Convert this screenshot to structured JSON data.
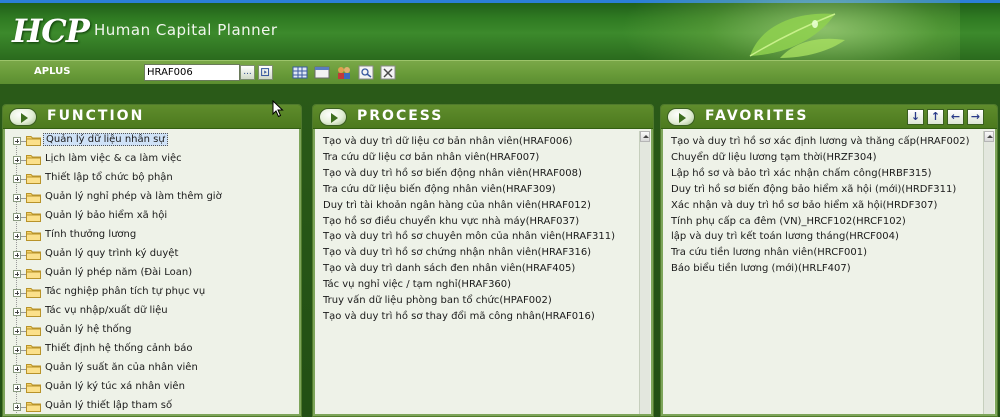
{
  "header": {
    "logo_text": "HCP",
    "app_title": "Human Capital Planner"
  },
  "toolbar": {
    "company": "APLUS",
    "function_code": "HRAF006",
    "lookup_label": "...",
    "icons": [
      "grid-icon",
      "window-icon",
      "users-icon",
      "search-icon",
      "tools-icon"
    ]
  },
  "function_panel": {
    "title": "FUNCTION",
    "items": [
      "Quản lý dữ liệu nhân sự",
      "Lịch làm việc & ca làm việc",
      "Thiết lập tổ chức bộ phận",
      "Quản lý nghỉ phép và làm thêm giờ",
      "Quản lý bảo hiểm xã hội",
      "Tính thưởng lương",
      "Quản lý quy trình ký duyệt",
      "Quản lý phép năm (Đài Loan)",
      "Tác nghiệp phân tích tự phục vụ",
      "Tác vụ nhập/xuất dữ liệu",
      "Quản lý hệ thống",
      "Thiết định hệ thống cảnh báo",
      "Quản lý suất ăn của nhân viên",
      "Quản lý ký túc xá nhân viên",
      "Quản lý thiết lập tham số"
    ],
    "selected_index": 0
  },
  "process_panel": {
    "title": "PROCESS",
    "items": [
      "Tạo và duy trì dữ liệu cơ bản nhân viên(HRAF006)",
      "Tra cứu dữ liệu cơ bản nhân viên(HRAF007)",
      "Tạo và duy trì hồ sơ biến động nhân viên(HRAF008)",
      "Tra cứu dữ liệu biến động nhân viên(HRAF309)",
      "Duy trì tài khoản ngân hàng của nhân viên(HRAF012)",
      "Tạo hồ sơ điều chuyển khu vực nhà máy(HRAF037)",
      "Tạo và duy trì hồ sơ chuyên môn của nhân viên(HRAF311)",
      "Tạo và duy trì hồ sơ chứng nhận nhân viên(HRAF316)",
      "Tạo và duy trì danh sách đen nhân viên(HRAF405)",
      "Tác vụ nghỉ việc / tạm nghỉ(HRAF360)",
      "Truy vấn dữ liệu phòng ban tổ chức(HPAF002)",
      "Tạo và duy trì hồ sơ thay đổi mã công nhân(HRAF016)"
    ]
  },
  "favorites_panel": {
    "title": "FAVORITES",
    "nav_buttons": [
      "↓",
      "↑",
      "←",
      "→"
    ],
    "items": [
      "Tạo và duy trì hồ sơ xác định lương và thăng cấp(HRAF002)",
      "Chuyển dữ liệu lương tạm thời(HRZF304)",
      "Lập hồ sơ và bảo trì xác nhận chấm công(HRBF315)",
      "Duy trì hồ sơ biến động bảo hiểm xã hội (mới)(HRDF311)",
      "Xác nhận và duy trì hồ sơ bảo hiểm xã hội(HRDF307)",
      "Tính phụ cấp ca đêm (VN)_HRCF102(HRCF102)",
      "lập và duy trì kết toán lương tháng(HRCF004)",
      "Tra cứu tiền lương nhân viên(HRCF001)",
      "Báo biểu tiền lương (mới)(HRLF407)"
    ]
  },
  "colors": {
    "header_green": "#2f7a22",
    "toolbar_green": "#6a9c3a",
    "panel_header": "#4c7a1e",
    "panel_body": "#eef2e8",
    "selection": "#cfe2f7"
  }
}
